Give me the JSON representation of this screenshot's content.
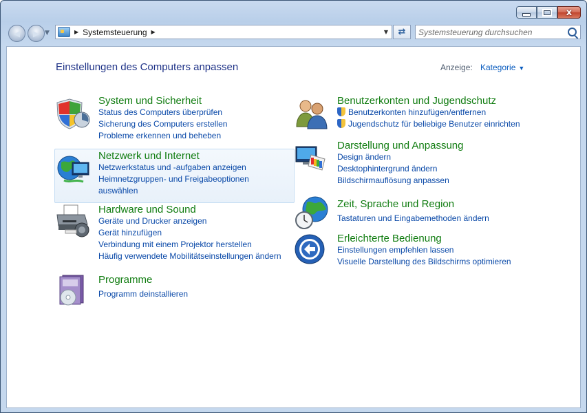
{
  "window": {
    "close_glyph": "x"
  },
  "address_bar": {
    "breadcrumb": "Systemsteuerung",
    "icon": "control-panel-icon"
  },
  "search": {
    "placeholder": "Systemsteuerung durchsuchen"
  },
  "heading": "Einstellungen des Computers anpassen",
  "view": {
    "label": "Anzeige:",
    "value": "Kategorie"
  },
  "categories": [
    {
      "title": "System und Sicherheit",
      "icon": "shield-icon",
      "links": [
        "Status des Computers überprüfen",
        "Sicherung des Computers erstellen",
        "Probleme erkennen und beheben"
      ]
    },
    {
      "title": "Netzwerk und Internet",
      "icon": "network-globe-icon",
      "links": [
        "Netzwerkstatus und -aufgaben anzeigen",
        "Heimnetzgruppen- und Freigabeoptionen",
        "auswählen"
      ]
    },
    {
      "title": "Hardware und Sound",
      "icon": "printer-icon",
      "links": [
        "Geräte und Drucker anzeigen",
        "Gerät hinzufügen",
        "Verbindung mit einem Projektor herstellen",
        "Häufig verwendete Mobilitätseinstellungen ändern"
      ]
    },
    {
      "title": "Programme",
      "icon": "programs-icon",
      "links": [
        "Programm deinstallieren"
      ]
    },
    {
      "title": "Benutzerkonten und Jugendschutz",
      "icon": "users-icon",
      "links": [
        "Benutzerkonten hinzufügen/entfernen",
        "Jugendschutz für beliebige Benutzer einrichten"
      ]
    },
    {
      "title": "Darstellung und Anpassung",
      "icon": "display-palette-icon",
      "links": [
        "Design ändern",
        "Desktophintergrund ändern",
        "Bildschirmauflösung anpassen"
      ]
    },
    {
      "title": "Zeit, Sprache und Region",
      "icon": "clock-globe-icon",
      "links": [
        "Tastaturen und Eingabemethoden ändern"
      ]
    },
    {
      "title": "Erleichterte Bedienung",
      "icon": "ease-of-access-icon",
      "links": [
        "Einstellungen empfehlen lassen",
        "Visuelle Darstellung des Bildschirms optimieren"
      ]
    }
  ]
}
